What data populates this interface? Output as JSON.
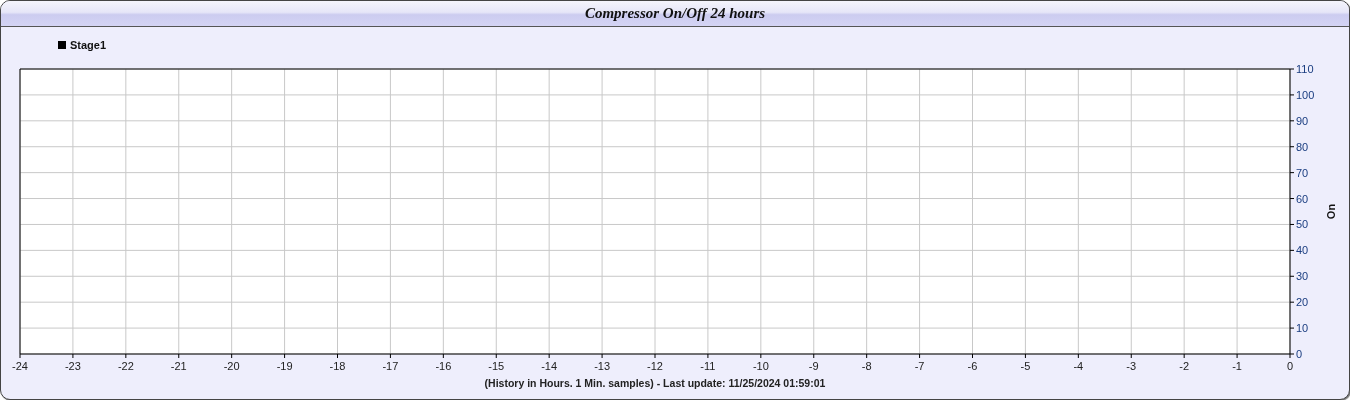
{
  "panel": {
    "title": "Compressor On/Off 24 hours"
  },
  "chart_data": {
    "type": "line",
    "xlabel": "(History in Hours. 1 Min. samples) - Last update: 11/25/2024 01:59:01",
    "ylabel": "On",
    "ylim": [
      0,
      110
    ],
    "grid": true,
    "categories": [
      "-24",
      "-23",
      "-22",
      "-21",
      "-20",
      "-19",
      "-18",
      "-17",
      "-16",
      "-15",
      "-14",
      "-13",
      "-12",
      "-11",
      "-10",
      "-9",
      "-8",
      "-7",
      "-6",
      "-5",
      "-4",
      "-3",
      "-2",
      "-1",
      "0"
    ],
    "yticks": [
      0,
      10,
      20,
      30,
      40,
      50,
      60,
      70,
      80,
      90,
      100,
      110
    ],
    "series": [
      {
        "name": "Stage1",
        "color": "#000000",
        "values": [
          null,
          null,
          null,
          null,
          null,
          null,
          null,
          null,
          null,
          null,
          null,
          null,
          null,
          null,
          null,
          null,
          null,
          null,
          null,
          null,
          null,
          null,
          null,
          null,
          null
        ]
      }
    ]
  }
}
